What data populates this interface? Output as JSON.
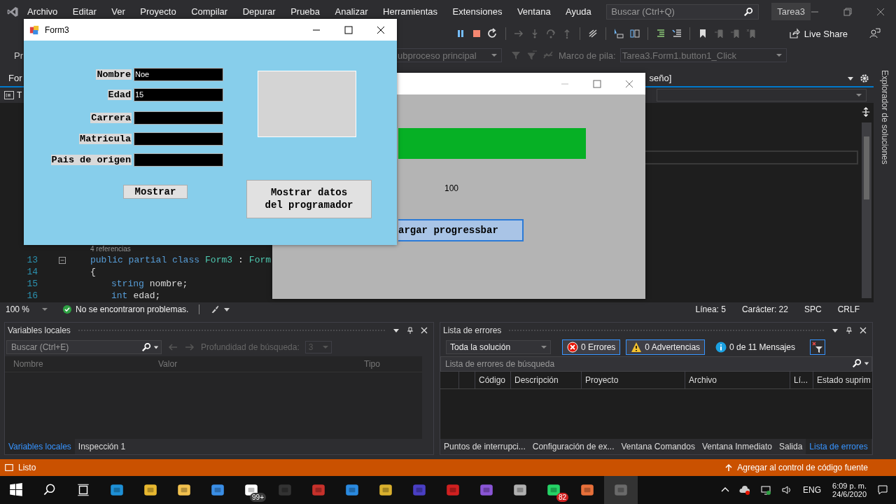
{
  "ide": {
    "menu": [
      "Archivo",
      "Editar",
      "Ver",
      "Proyecto",
      "Compilar",
      "Depurar",
      "Prueba",
      "Analizar",
      "Herramientas",
      "Extensiones",
      "Ventana",
      "Ayuda"
    ],
    "search_placeholder": "Buscar (Ctrl+Q)",
    "solution": "Tarea3",
    "live_share": "Live Share",
    "toolbar2": {
      "left_text": "Pr",
      "thread": "ubproceso principal",
      "stack_label": "Marco de pila:",
      "stack_value": "Tarea3.Form1.button1_Click"
    },
    "doc_tab_left": "For",
    "doc_tab_right": "seño]",
    "file_tab": "T",
    "editor": {
      "references": "4 referencias",
      "lines": [
        {
          "number": "13",
          "kind": "declaration",
          "tokens": [
            {
              "text": "public partial class",
              "kind": "keyword"
            },
            {
              "text": "Form3",
              "kind": "type"
            },
            {
              "text": ":",
              "kind": "plain"
            },
            {
              "text": "Form",
              "kind": "type"
            }
          ]
        },
        {
          "number": "14",
          "kind": "brace",
          "tokens": [
            {
              "text": "{",
              "kind": "plain"
            }
          ]
        },
        {
          "number": "15",
          "kind": "member",
          "tokens": [
            {
              "text": "string",
              "kind": "keyword"
            },
            {
              "text": "nombre;",
              "kind": "plain"
            }
          ]
        },
        {
          "number": "16",
          "kind": "member",
          "tokens": [
            {
              "text": "int",
              "kind": "keyword"
            },
            {
              "text": "edad;",
              "kind": "plain"
            }
          ]
        }
      ]
    },
    "editor_status": {
      "zoom": "100 %",
      "problems": "No se encontraron problemas.",
      "line": "Línea: 5",
      "column": "Carácter: 22",
      "spacing": "SPC",
      "line_ending": "CRLF"
    },
    "side_panel": "Explorador de soluciones"
  },
  "locals_panel": {
    "title": "Variables locales",
    "search_placeholder": "Buscar (Ctrl+E)",
    "depth_label": "Profundidad de búsqueda:",
    "depth_value": "3",
    "columns": [
      "Nombre",
      "Valor",
      "Tipo"
    ],
    "tabs": [
      {
        "label": "Variables locales",
        "selected": true
      },
      {
        "label": "Inspección 1",
        "selected": false
      }
    ]
  },
  "errors_panel": {
    "title": "Lista de errores",
    "scope": "Toda la solución",
    "filters": [
      {
        "kind": "error",
        "label": "0 Errores",
        "selected": true
      },
      {
        "kind": "warning",
        "label": "0 Advertencias",
        "selected": true
      },
      {
        "kind": "info",
        "label": "0 de 11 Mensajes",
        "selected": false
      }
    ],
    "search_placeholder": "Lista de errores de búsqueda",
    "columns": [
      "Código",
      "Descripción",
      "Proyecto",
      "Archivo",
      "Lí...",
      "Estado suprim"
    ],
    "tabs": [
      {
        "label": "Puntos de interrupci...",
        "selected": false
      },
      {
        "label": "Configuración de ex...",
        "selected": false
      },
      {
        "label": "Ventana Comandos",
        "selected": false
      },
      {
        "label": "Ventana Inmediato",
        "selected": false
      },
      {
        "label": "Salida",
        "selected": false
      },
      {
        "label": "Lista de errores",
        "selected": true
      }
    ]
  },
  "status_bar": {
    "text": "Listo",
    "source_control": "Agregar al control de código fuente"
  },
  "form3": {
    "title": "Form3",
    "fields": [
      {
        "label": "Nombre",
        "value": "Noe"
      },
      {
        "label": "Edad",
        "value": "15"
      },
      {
        "label": "Carrera"
      },
      {
        "label": "Matricula"
      },
      {
        "label": "Pais de origen"
      }
    ],
    "buttons": [
      "Mostrar",
      "Mostrar datos del programador"
    ]
  },
  "form1": {
    "progress": {
      "level": 1
    },
    "value_label": "100",
    "button": "argar progressbar"
  },
  "taskbar": {
    "mail_badge": "99+",
    "chat_badge": "82",
    "language": "ENG",
    "time": "6:09 p. m.",
    "date": "24/6/2020"
  }
}
